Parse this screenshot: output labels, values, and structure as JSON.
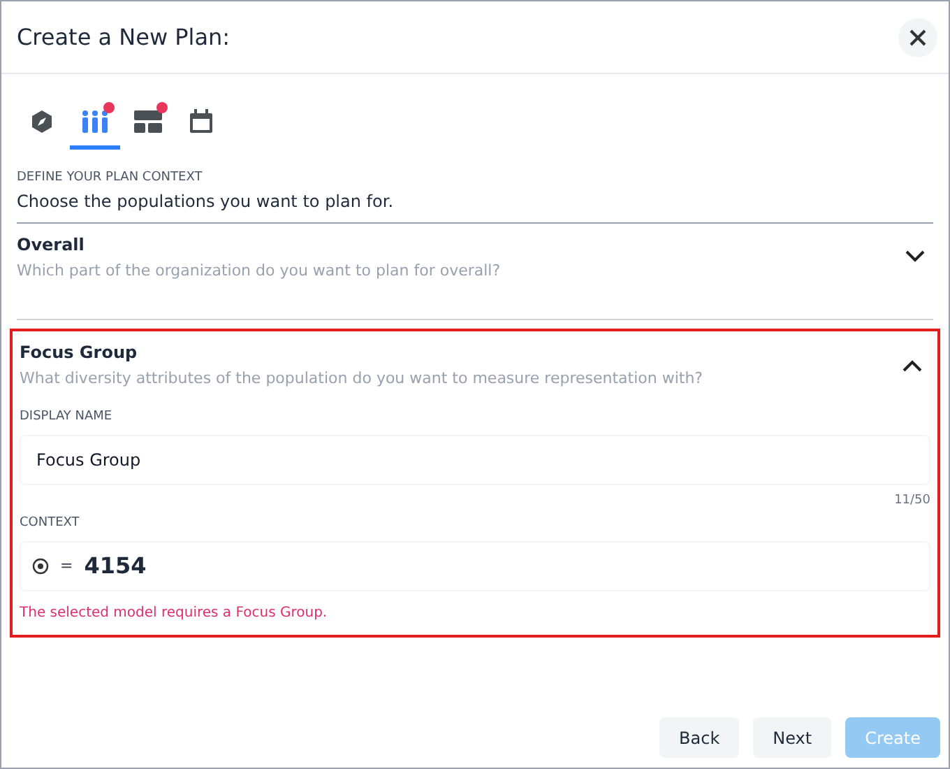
{
  "dialog": {
    "title": "Create a New Plan:"
  },
  "tabs": [
    {
      "kind": "compass",
      "selected": false,
      "badge": false
    },
    {
      "kind": "people",
      "selected": true,
      "badge": true
    },
    {
      "kind": "layout",
      "selected": false,
      "badge": true
    },
    {
      "kind": "calendar",
      "selected": false,
      "badge": false
    }
  ],
  "section_label": "DEFINE YOUR PLAN CONTEXT",
  "section_subtitle": "Choose the populations you want to plan for.",
  "panels": [
    {
      "title": "Overall",
      "description": "Which part of the organization do you want to plan for overall?",
      "expanded": false,
      "highlighted": false
    },
    {
      "title": "Focus Group",
      "description": "What diversity attributes of the population do you want to measure representation with?",
      "expanded": true,
      "highlighted": true,
      "display_name": {
        "label": "DISPLAY NAME",
        "value": "Focus Group",
        "counter": "11/50"
      },
      "context": {
        "label": "CONTEXT",
        "operator": "=",
        "value": "4154"
      },
      "error": "The selected model requires a Focus Group."
    }
  ],
  "buttons": [
    {
      "label": "Back",
      "disabled": false
    },
    {
      "label": "Next",
      "disabled": false
    },
    {
      "label": "Create",
      "disabled": true
    }
  ]
}
